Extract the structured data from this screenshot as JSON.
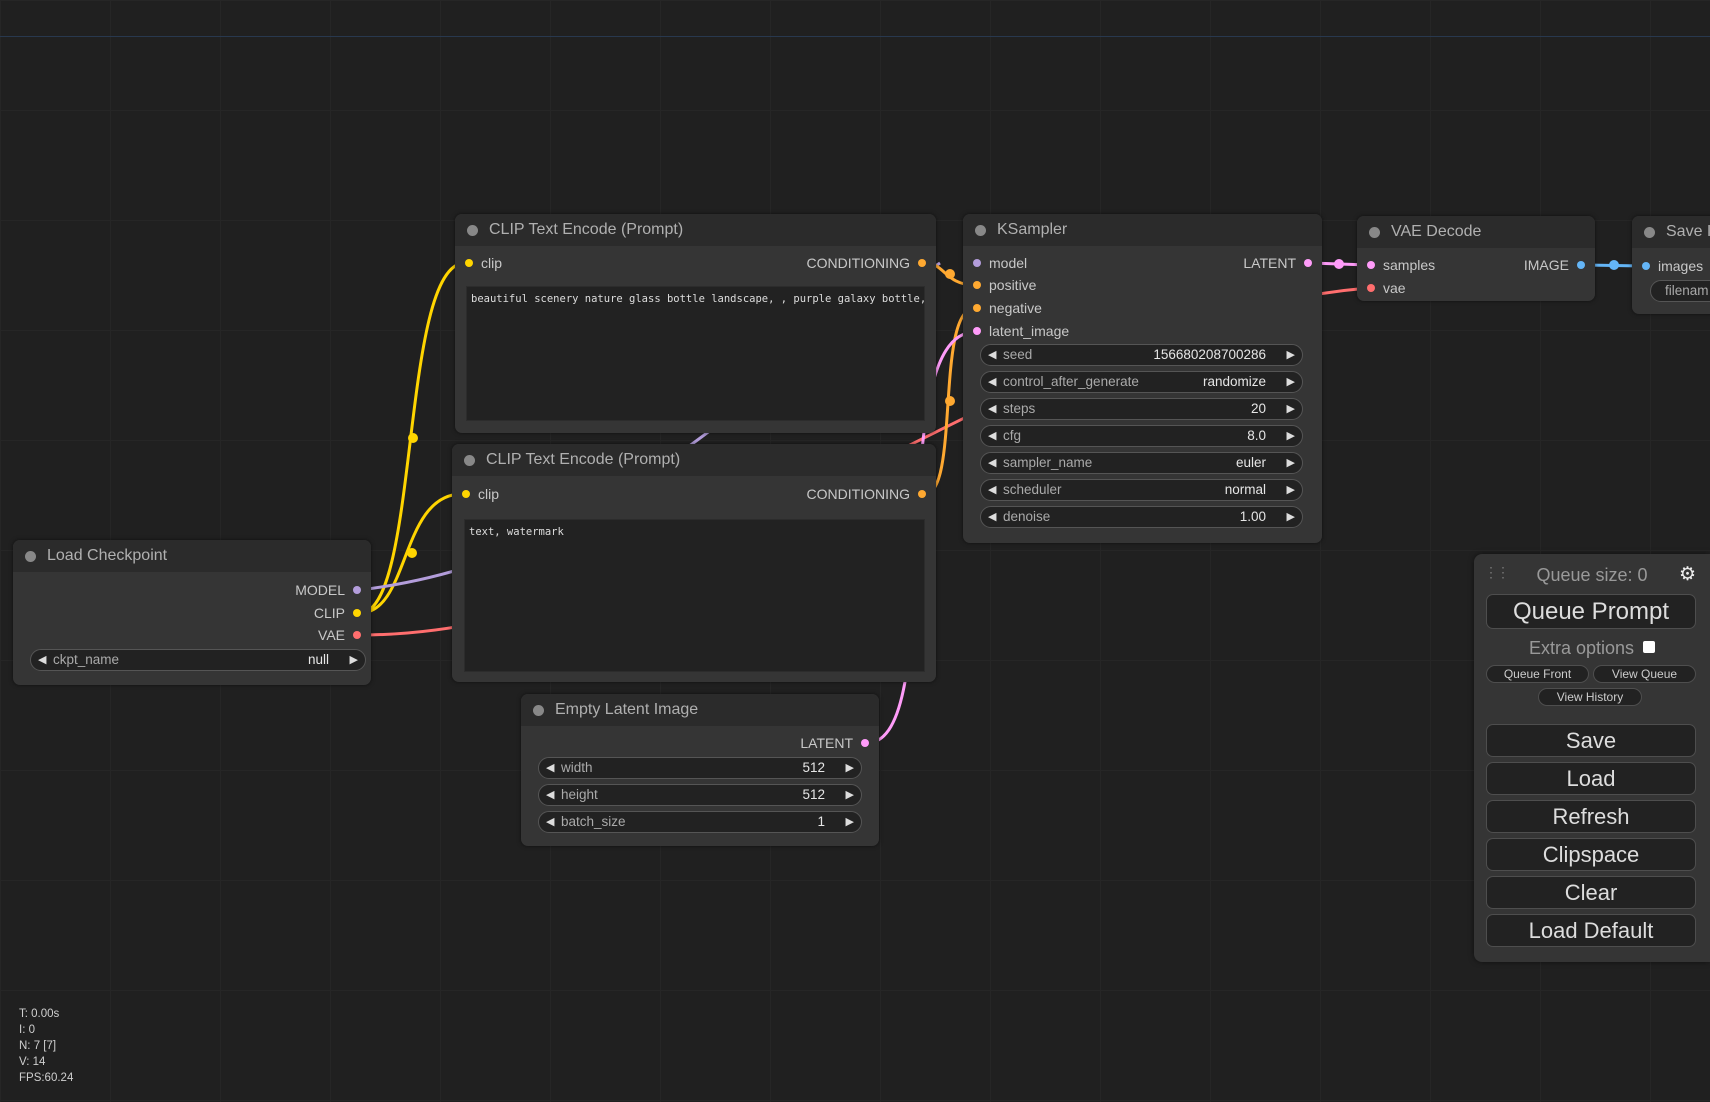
{
  "nodes": {
    "clip_pos": {
      "title": "CLIP Text Encode (Prompt)",
      "input": "clip",
      "output": "CONDITIONING",
      "text": "beautiful scenery nature glass bottle landscape, , purple galaxy bottle,"
    },
    "clip_neg": {
      "title": "CLIP Text Encode (Prompt)",
      "input": "clip",
      "output": "CONDITIONING",
      "text": "text, watermark"
    },
    "ksampler": {
      "title": "KSampler",
      "inputs": [
        "model",
        "positive",
        "negative",
        "latent_image"
      ],
      "output": "LATENT",
      "widgets": [
        {
          "label": "seed",
          "value": "156680208700286"
        },
        {
          "label": "control_after_generate",
          "value": "randomize"
        },
        {
          "label": "steps",
          "value": "20"
        },
        {
          "label": "cfg",
          "value": "8.0"
        },
        {
          "label": "sampler_name",
          "value": "euler"
        },
        {
          "label": "scheduler",
          "value": "normal"
        },
        {
          "label": "denoise",
          "value": "1.00"
        }
      ]
    },
    "vae_decode": {
      "title": "VAE Decode",
      "inputs": [
        "samples",
        "vae"
      ],
      "output": "IMAGE"
    },
    "save_image": {
      "title": "Save I",
      "input": "images",
      "widget_label": "filenam"
    },
    "load_checkpoint": {
      "title": "Load Checkpoint",
      "outputs": [
        "MODEL",
        "CLIP",
        "VAE"
      ],
      "widget": {
        "label": "ckpt_name",
        "value": "null"
      }
    },
    "empty_latent": {
      "title": "Empty Latent Image",
      "output": "LATENT",
      "widgets": [
        {
          "label": "width",
          "value": "512"
        },
        {
          "label": "height",
          "value": "512"
        },
        {
          "label": "batch_size",
          "value": "1"
        }
      ]
    }
  },
  "slot_colors": {
    "clip": "#ffd500",
    "conditioning": "#ffa931",
    "model": "#b39ddb",
    "latent": "#ff9cf9",
    "vae": "#ff6e6e",
    "image": "#64b5f6"
  },
  "panel": {
    "queue_size": "Queue size: 0",
    "queue_prompt": "Queue Prompt",
    "extra_options": "Extra options",
    "queue_front": "Queue Front",
    "view_queue": "View Queue",
    "view_history": "View History",
    "buttons": [
      "Save",
      "Load",
      "Refresh",
      "Clipspace",
      "Clear",
      "Load Default"
    ]
  },
  "stats": [
    "T: 0.00s",
    "I: 0",
    "N: 7 [7]",
    "V: 14",
    "FPS:60.24"
  ]
}
